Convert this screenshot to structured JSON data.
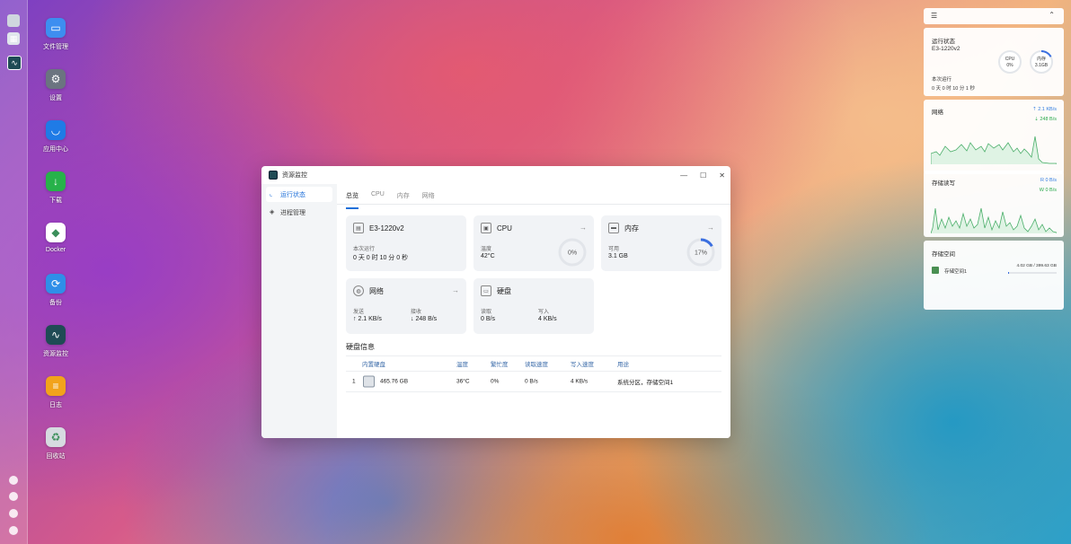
{
  "desktop": {
    "icons": [
      {
        "label": "文件管理",
        "color": "#3d8ef0",
        "glyph": "▭"
      },
      {
        "label": "设置",
        "color": "#6b7480",
        "glyph": "⚙"
      },
      {
        "label": "应用中心",
        "color": "#1f7be6",
        "glyph": "◡"
      },
      {
        "label": "下载",
        "color": "#27b24a",
        "glyph": "↓"
      },
      {
        "label": "Docker",
        "color": "#ffffff",
        "glyph": "◆"
      },
      {
        "label": "备份",
        "color": "#2f8fe8",
        "glyph": "⟳"
      },
      {
        "label": "资源监控",
        "color": "#1f4b55",
        "glyph": "∿"
      },
      {
        "label": "日志",
        "color": "#f2a31b",
        "glyph": "≡"
      },
      {
        "label": "回收站",
        "color": "#d6dbe0",
        "glyph": "♻"
      }
    ]
  },
  "window": {
    "title": "资源监控",
    "sidebar": [
      "运行状态",
      "进程管理"
    ],
    "tabs": [
      "总览",
      "CPU",
      "内存",
      "网络"
    ],
    "system": {
      "name": "E3-1220v2",
      "uptime_label": "本次运行",
      "uptime": "0 天 0 时 10 分 0 秒"
    },
    "cpu": {
      "title": "CPU",
      "temp_label": "温度",
      "temp": "42°C",
      "percent_text": "0%",
      "percent": 0
    },
    "memory": {
      "title": "内存",
      "avail_label": "可用",
      "avail": "3.1 GB",
      "percent_text": "17%",
      "percent": 17
    },
    "network": {
      "title": "网络",
      "send_label": "发送",
      "send": "↑ 2.1 KB/s",
      "recv_label": "接收",
      "recv": "↓ 248 B/s"
    },
    "disk": {
      "title": "硬盘",
      "read_label": "读取",
      "read": "0 B/s",
      "write_label": "写入",
      "write": "4 KB/s"
    },
    "disk_info": {
      "title": "硬盘信息",
      "headers": [
        "内置硬盘",
        "温度",
        "繁忙度",
        "读取速度",
        "写入速度",
        "用途"
      ],
      "rows": [
        [
          "1",
          "465.76 GB",
          "36°C",
          "0%",
          "0 B/s",
          "4 KB/s",
          "系统分区，存储空间1"
        ]
      ]
    }
  },
  "widgets": {
    "status": {
      "title": "运行状态",
      "host": "E3-1220v2",
      "cpu_label": "CPU",
      "cpu_value": "0%",
      "mem_label": "内存",
      "mem_value": "3.1GB",
      "mem_percent": 17,
      "uptime_label": "本次运行",
      "uptime": "0 天 0 时 10 分 1 秒"
    },
    "network": {
      "title": "网络",
      "up": "2.1 KB/s",
      "down": "248 B/s",
      "up_color": "#2f7be0",
      "down_color": "#27a84a"
    },
    "storage_io": {
      "title": "存储读写",
      "read": "R  0 B/s",
      "write": "W  0 B/s",
      "read_color": "#2f7be0",
      "write_color": "#27a84a"
    },
    "storage": {
      "title": "存储空间",
      "name": "存储空间1",
      "usage": "4.02 GB / 399.63 GB",
      "used_fraction": 0.01
    }
  }
}
